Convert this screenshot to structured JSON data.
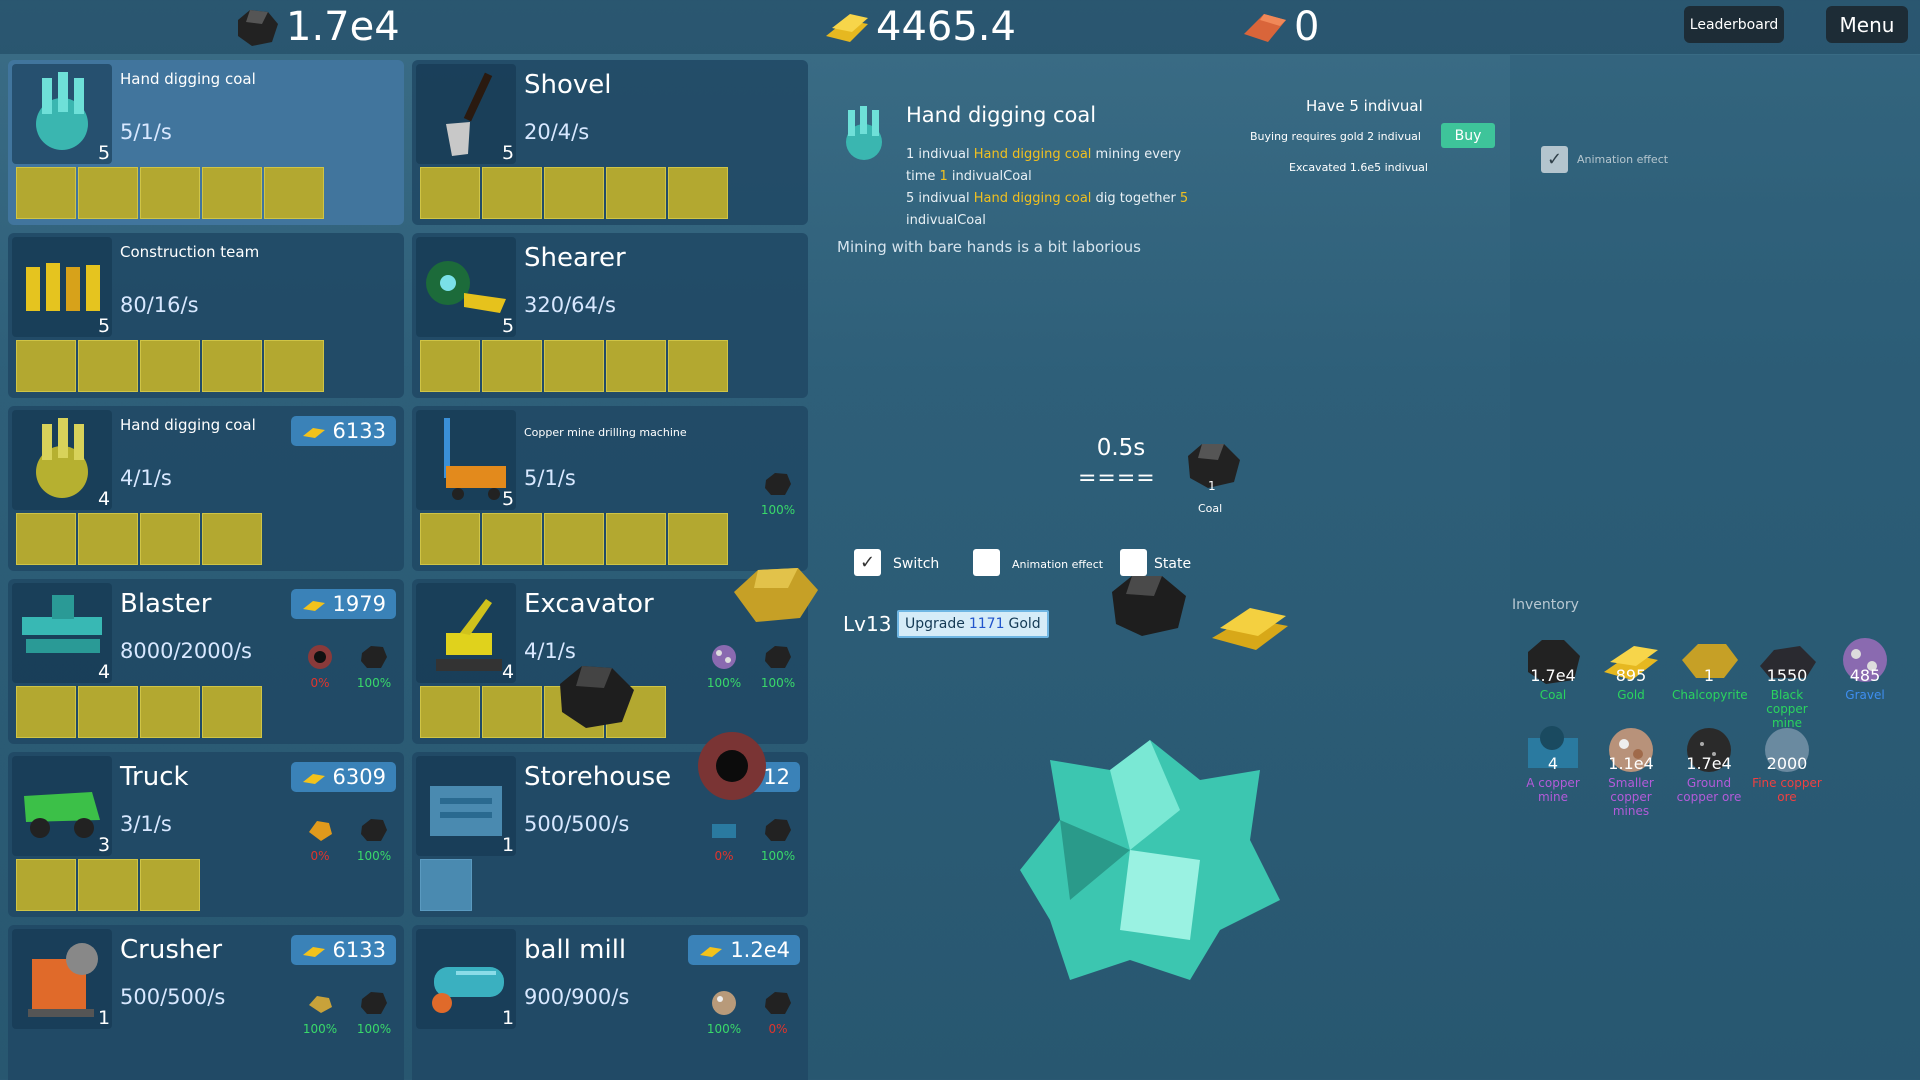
{
  "resources": {
    "coal": "1.7e4",
    "gold": "4465.4",
    "copper": "0"
  },
  "top_buttons": {
    "leaderboard": "Leaderboard",
    "menu": "Menu"
  },
  "cards": [
    {
      "title": "Hand digging coal",
      "rate": "5/1/s",
      "count": "5",
      "price": "",
      "selected": true
    },
    {
      "title": "Shovel",
      "rate": "20/4/s",
      "count": "5",
      "price": ""
    },
    {
      "title": "Construction team",
      "rate": "80/16/s",
      "count": "5",
      "price": ""
    },
    {
      "title": "Shearer",
      "rate": "320/64/s",
      "count": "5",
      "price": ""
    },
    {
      "title": "Hand digging coal",
      "rate": "4/1/s",
      "count": "4",
      "price": "6133"
    },
    {
      "title": "Copper mine drilling machine",
      "rate": "5/1/s",
      "count": "5",
      "price": "",
      "inputs": [
        "100%"
      ]
    },
    {
      "title": "Blaster",
      "rate": "8000/2000/s",
      "count": "4",
      "price": "1979",
      "inputs": [
        "0%",
        "100%"
      ]
    },
    {
      "title": "Excavator",
      "rate": "4/1/s",
      "count": "4",
      "price": "",
      "inputs": [
        "100%",
        "100%"
      ]
    },
    {
      "title": "Truck",
      "rate": "3/1/s",
      "count": "3",
      "price": "6309",
      "inputs": [
        "0%",
        "100%"
      ]
    },
    {
      "title": "Storehouse",
      "rate": "500/500/s",
      "count": "1",
      "price": "12",
      "inputs": [
        "0%",
        "100%"
      ]
    },
    {
      "title": "Crusher",
      "rate": "500/500/s",
      "count": "1",
      "price": "6133",
      "inputs": [
        "100%",
        "100%"
      ]
    },
    {
      "title": "ball mill",
      "rate": "900/900/s",
      "count": "1",
      "price": "1.2e4",
      "inputs": [
        "100%",
        "0%"
      ]
    }
  ],
  "detail": {
    "title": "Hand digging coal",
    "line1_a": "1 indivual ",
    "line1_hl": "Hand digging coal",
    "line1_b": " mining every",
    "line2_a": "time ",
    "line2_hl": "1",
    "line2_b": " indivualCoal",
    "line3_a": "5 indivual ",
    "line3_hl": "Hand digging coal",
    "line3_b": " dig together ",
    "line3_hl2": "5",
    "line4": "indivualCoal",
    "desc": "Mining with bare hands is a bit laborious",
    "have": "Have 5 indivual",
    "buy_req": "Buying requires gold 2 indivual",
    "buy": "Buy",
    "excavated": "Excavated 1.6e5 indivual",
    "anim_label": "Animation effect"
  },
  "production": {
    "timer": "0.5s",
    "bar": "====",
    "output_qty": "1",
    "output_name": "Coal",
    "switch_label": "Switch",
    "anim_label": "Animation effect",
    "state_label": "State",
    "level": "Lv13",
    "upgrade_a": "Upgrade",
    "upgrade_num": "1171",
    "upgrade_b": "Gold"
  },
  "inventory": {
    "title": "Inventory",
    "items": [
      {
        "qty": "1.7e4",
        "name": "Coal",
        "color": "green"
      },
      {
        "qty": "895",
        "name": "Gold",
        "color": "green"
      },
      {
        "qty": "1",
        "name": "Chalcopyrite",
        "color": "green"
      },
      {
        "qty": "1550",
        "name": "Black copper mine",
        "color": "green"
      },
      {
        "qty": "485",
        "name": "Gravel",
        "color": "blue"
      },
      {
        "qty": "4",
        "name": "A copper mine",
        "color": "purple"
      },
      {
        "qty": "1.1e4",
        "name": "Smaller copper mines",
        "color": "purple"
      },
      {
        "qty": "1.7e4",
        "name": "Ground copper ore",
        "color": "purple"
      },
      {
        "qty": "2000",
        "name": "Fine copper ore",
        "color": "red"
      }
    ]
  },
  "colors": {
    "accent": "#3a82b8",
    "buy": "#3ec49a",
    "highlight": "#f0c020",
    "pct_green": "#39d96a",
    "pct_red": "#e0342c"
  }
}
